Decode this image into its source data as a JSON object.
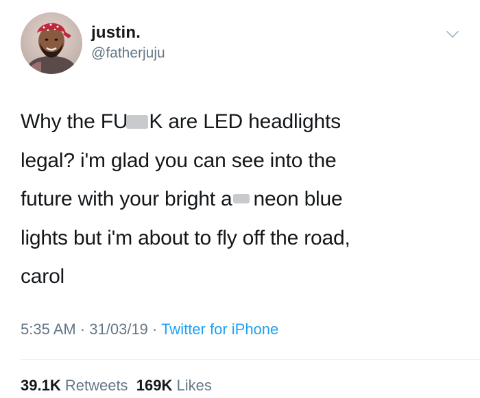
{
  "user": {
    "display_name": "justin.",
    "handle": "@fatherjuju",
    "avatar_icon": "user-avatar"
  },
  "menu_icon": "chevron-down-icon",
  "tweet": {
    "lines": [
      [
        "Why the FU",
        "K are LED headlights"
      ],
      [
        "legal? i'm glad you can see into the"
      ],
      [
        "future with your bright a",
        "neon blue"
      ],
      [
        "lights but i'm about to fly off the road,"
      ],
      [
        "carol"
      ]
    ]
  },
  "meta": {
    "time": "5:35 AM",
    "separator": " · ",
    "date": "31/03/19",
    "source": "Twitter for iPhone"
  },
  "stats": {
    "retweets_count": "39.1K",
    "retweets_label": "Retweets",
    "likes_count": "169K",
    "likes_label": "Likes"
  },
  "colors": {
    "text": "#14171a",
    "secondary": "#657786",
    "link": "#1da1f2",
    "divider": "#e6ecf0"
  }
}
